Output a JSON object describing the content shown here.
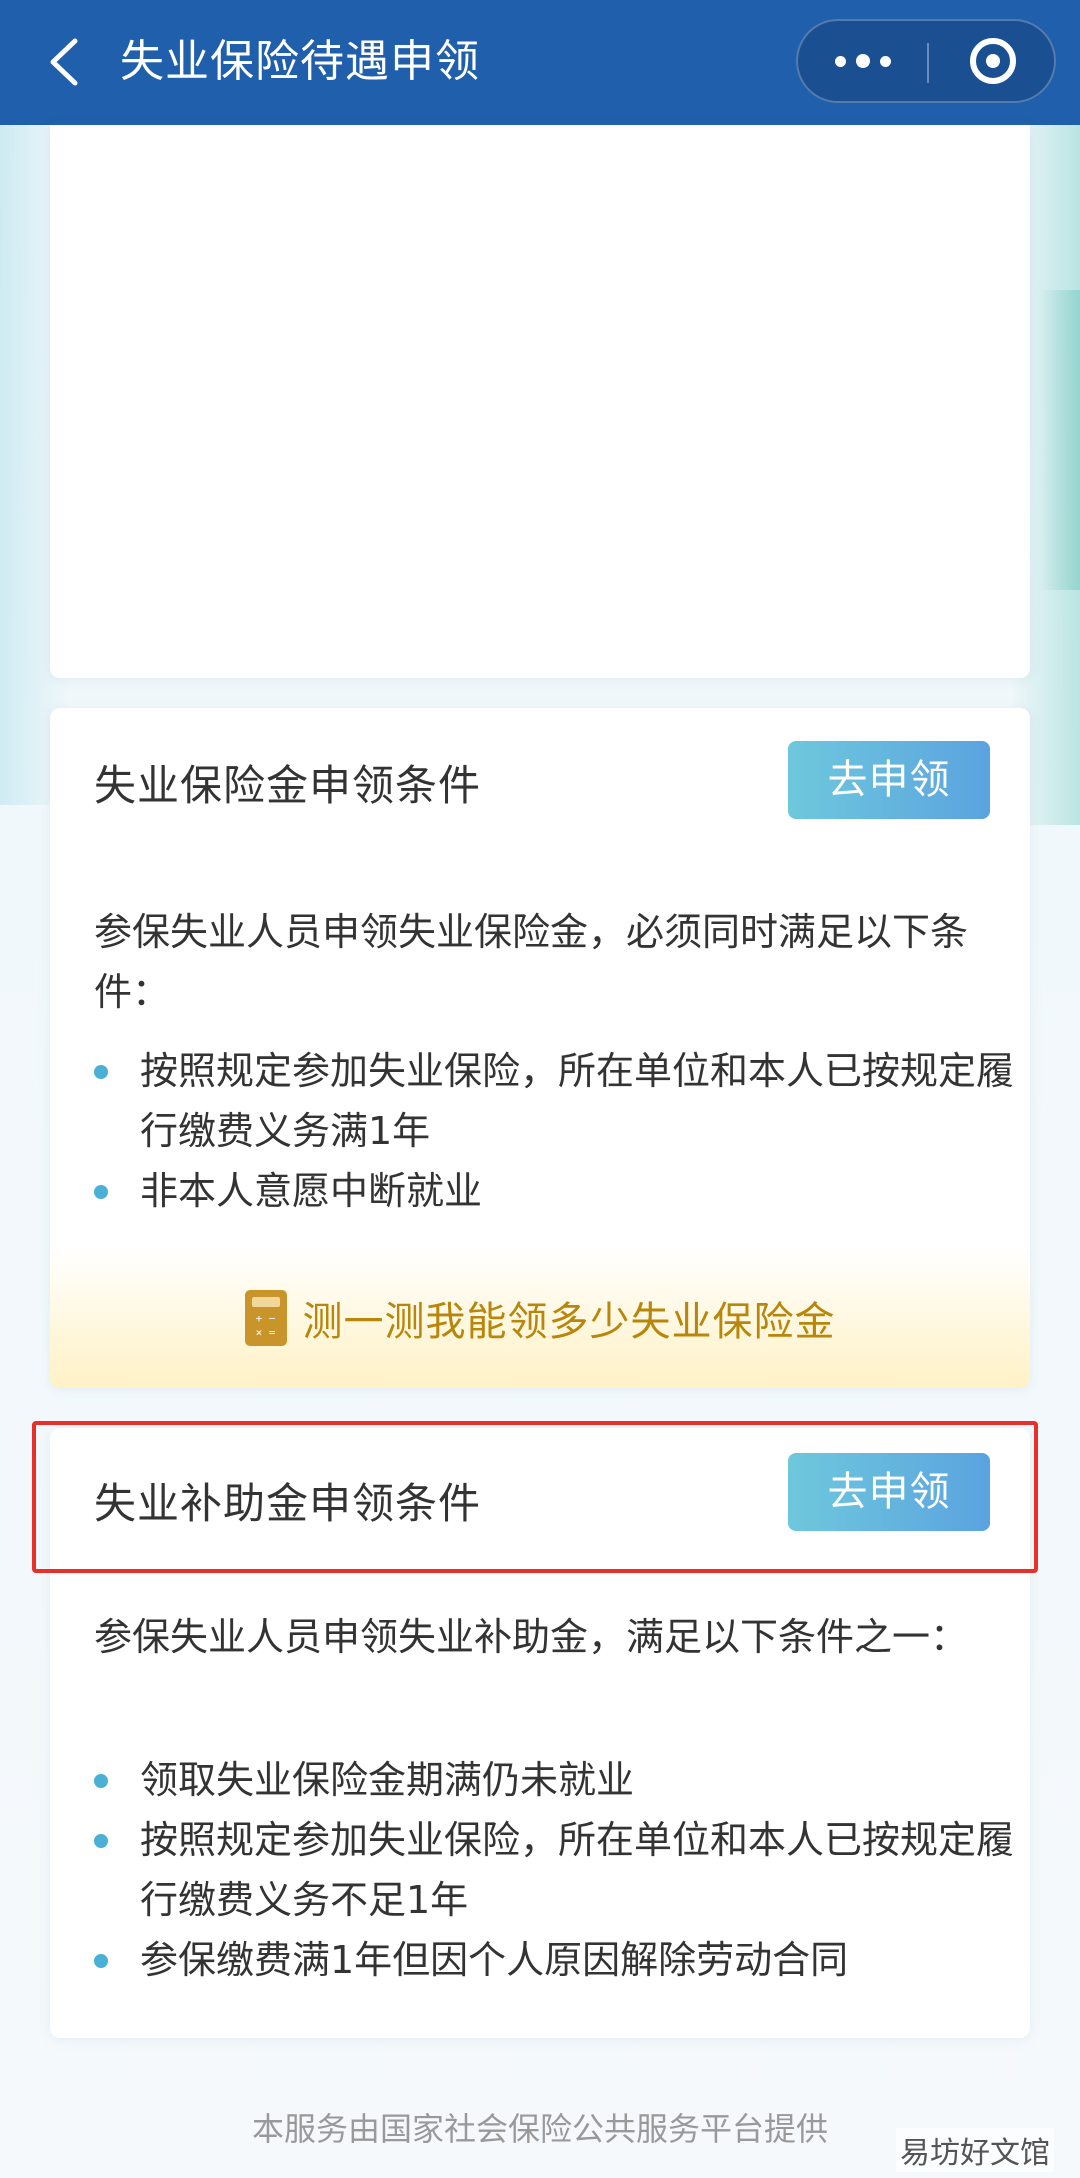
{
  "header": {
    "title": "失业保险待遇申领",
    "back_icon": "chevron-left-icon",
    "more_icon": "more-dots-icon",
    "close_icon": "target-ring-icon"
  },
  "card_unemployment_insurance": {
    "heading": "失业保险金申领条件",
    "apply_label": "去申领",
    "intro": "参保失业人员申领失业保险金，必须同时满足以下条件：",
    "conditions": [
      "按照规定参加失业保险，所在单位和本人已按规定履行缴费义务满1年",
      "非本人意愿中断就业"
    ],
    "calc_link": "测一测我能领多少失业保险金",
    "calc_icon": "calculator-icon"
  },
  "card_unemployment_subsidy": {
    "heading": "失业补助金申领条件",
    "apply_label": "去申领",
    "intro": "参保失业人员申领失业补助金，满足以下条件之一：",
    "conditions": [
      "领取失业保险金期满仍未就业",
      "按照规定参加失业保险，所在单位和本人已按规定履行缴费义务不足1年",
      "参保缴费满1年但因个人原因解除劳动合同"
    ]
  },
  "footer": {
    "provider": "本服务由国家社会保险公共服务平台提供",
    "watermark": "易坊好文馆"
  },
  "colors": {
    "header_bg": "#1f5fab",
    "accent": "#5ba3e0",
    "highlight": "#e8302a",
    "calc_gold": "#b8860b"
  }
}
